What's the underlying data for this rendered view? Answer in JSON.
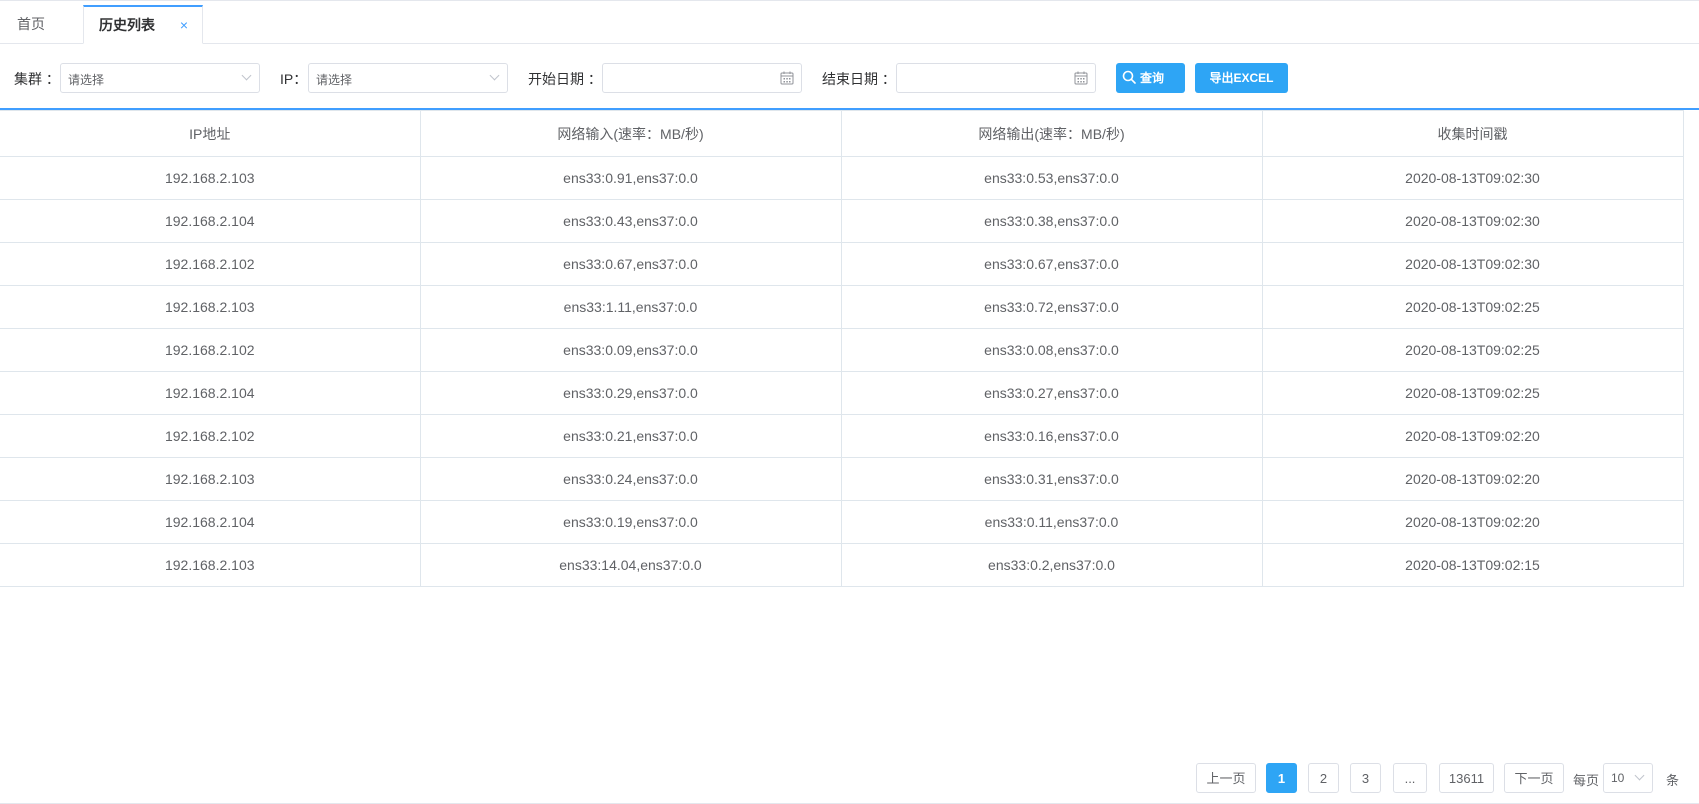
{
  "tabs": {
    "home": "首页",
    "active": "历史列表",
    "close": "×"
  },
  "filters": {
    "cluster_label": "集群 ：",
    "cluster_placeholder": "请选择",
    "ip_label": "IP：",
    "ip_placeholder": "请选择",
    "start_label": "开始日期 ：",
    "start_value": "",
    "end_label": "结束日期 ：",
    "end_value": "",
    "query_button": "查询",
    "export_button": "导出EXCEL"
  },
  "table": {
    "columns": [
      "IP地址",
      "网络输入(速率：MB/秒)",
      "网络输出(速率：MB/秒)",
      "收集时间戳"
    ],
    "rows": [
      [
        "192.168.2.103",
        "ens33:0.91,ens37:0.0",
        "ens33:0.53,ens37:0.0",
        "2020-08-13T09:02:30"
      ],
      [
        "192.168.2.104",
        "ens33:0.43,ens37:0.0",
        "ens33:0.38,ens37:0.0",
        "2020-08-13T09:02:30"
      ],
      [
        "192.168.2.102",
        "ens33:0.67,ens37:0.0",
        "ens33:0.67,ens37:0.0",
        "2020-08-13T09:02:30"
      ],
      [
        "192.168.2.103",
        "ens33:1.11,ens37:0.0",
        "ens33:0.72,ens37:0.0",
        "2020-08-13T09:02:25"
      ],
      [
        "192.168.2.102",
        "ens33:0.09,ens37:0.0",
        "ens33:0.08,ens37:0.0",
        "2020-08-13T09:02:25"
      ],
      [
        "192.168.2.104",
        "ens33:0.29,ens37:0.0",
        "ens33:0.27,ens37:0.0",
        "2020-08-13T09:02:25"
      ],
      [
        "192.168.2.102",
        "ens33:0.21,ens37:0.0",
        "ens33:0.16,ens37:0.0",
        "2020-08-13T09:02:20"
      ],
      [
        "192.168.2.103",
        "ens33:0.24,ens37:0.0",
        "ens33:0.31,ens37:0.0",
        "2020-08-13T09:02:20"
      ],
      [
        "192.168.2.104",
        "ens33:0.19,ens37:0.0",
        "ens33:0.11,ens37:0.0",
        "2020-08-13T09:02:20"
      ],
      [
        "192.168.2.103",
        "ens33:14.04,ens37:0.0",
        "ens33:0.2,ens37:0.0",
        "2020-08-13T09:02:15"
      ]
    ]
  },
  "pagination": {
    "prev": "上一页",
    "pages": [
      "1",
      "2",
      "3",
      "...",
      "13611"
    ],
    "current": "1",
    "next": "下一页",
    "per_page_label": "每页",
    "page_size": "10",
    "unit": "条"
  },
  "colors": {
    "accent": "#409eff",
    "button": "#2ea5f5",
    "border": "#dfe6ec"
  },
  "icons": {
    "query": "search-icon",
    "date": "calendar-icon",
    "select": "chevron-down-icon"
  }
}
